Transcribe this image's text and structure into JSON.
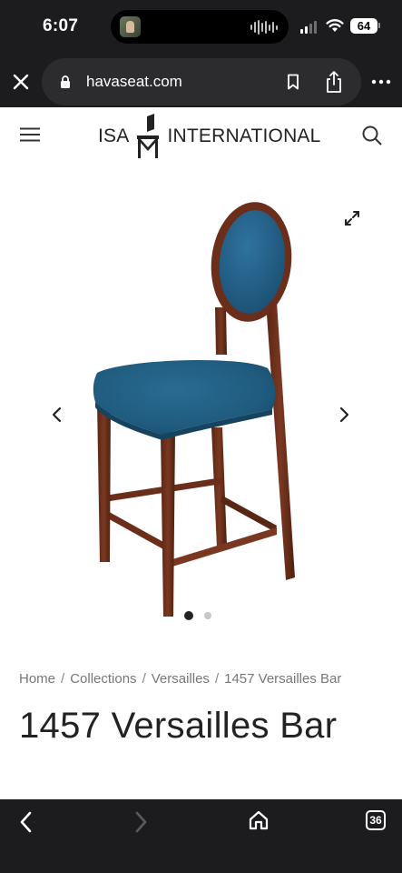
{
  "status_bar": {
    "time": "6:07",
    "battery_level": "64"
  },
  "browser": {
    "url": "havaseat.com",
    "tab_count": "36"
  },
  "site": {
    "logo_left": "ISA",
    "logo_right": "INTERNATIONAL"
  },
  "gallery": {
    "current_slide": 1,
    "total_slides": 2
  },
  "breadcrumb": {
    "items": [
      "Home",
      "Collections",
      "Versailles",
      "1457 Versailles Bar"
    ],
    "separator": "/"
  },
  "product": {
    "title": "1457 Versailles Bar"
  },
  "colors": {
    "chrome_dark": "#1c1c1e",
    "upholstery_blue": "#1f5b7e",
    "wood_brown": "#6b2e1a"
  }
}
